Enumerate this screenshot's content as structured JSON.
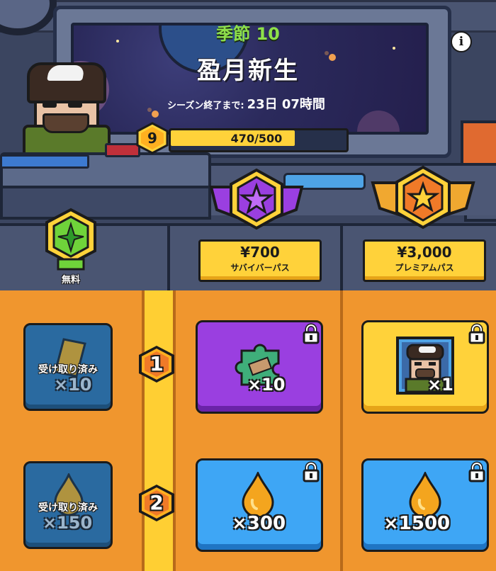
{
  "season": {
    "label": "季節 10",
    "name": "盈月新生",
    "countdown_label": "シーズン終了まで:",
    "countdown_value": "23日 07時間"
  },
  "level": {
    "current": "9",
    "progress_text": "470/500",
    "progress_fraction": 0.94
  },
  "tiers": {
    "free": {
      "label": "無料"
    },
    "survivor": {
      "price": "¥700",
      "name": "サバイバーパス"
    },
    "premium": {
      "price": "¥3,000",
      "name": "プレミアムパス"
    }
  },
  "rows": [
    {
      "number": "1",
      "free": {
        "status": "受け取り済み",
        "qty": "×10",
        "icon": "gold-bar-icon"
      },
      "survivor": {
        "qty": "×10",
        "icon": "puzzle-piece-icon",
        "locked": true
      },
      "premium": {
        "qty": "×1",
        "icon": "character-portrait-icon",
        "locked": true
      }
    },
    {
      "number": "2",
      "free": {
        "status": "受け取り済み",
        "qty": "×150",
        "icon": "oil-drop-icon"
      },
      "survivor": {
        "qty": "×300",
        "icon": "oil-drop-icon",
        "locked": true
      },
      "premium": {
        "qty": "×1500",
        "icon": "oil-drop-icon",
        "locked": true
      }
    }
  ],
  "colors": {
    "season_green": "#8ee04a",
    "accent_yellow": "#ffd23a",
    "reward_orange": "#f0962e",
    "purple": "#9a3fe0",
    "blue": "#3ea6f5"
  }
}
